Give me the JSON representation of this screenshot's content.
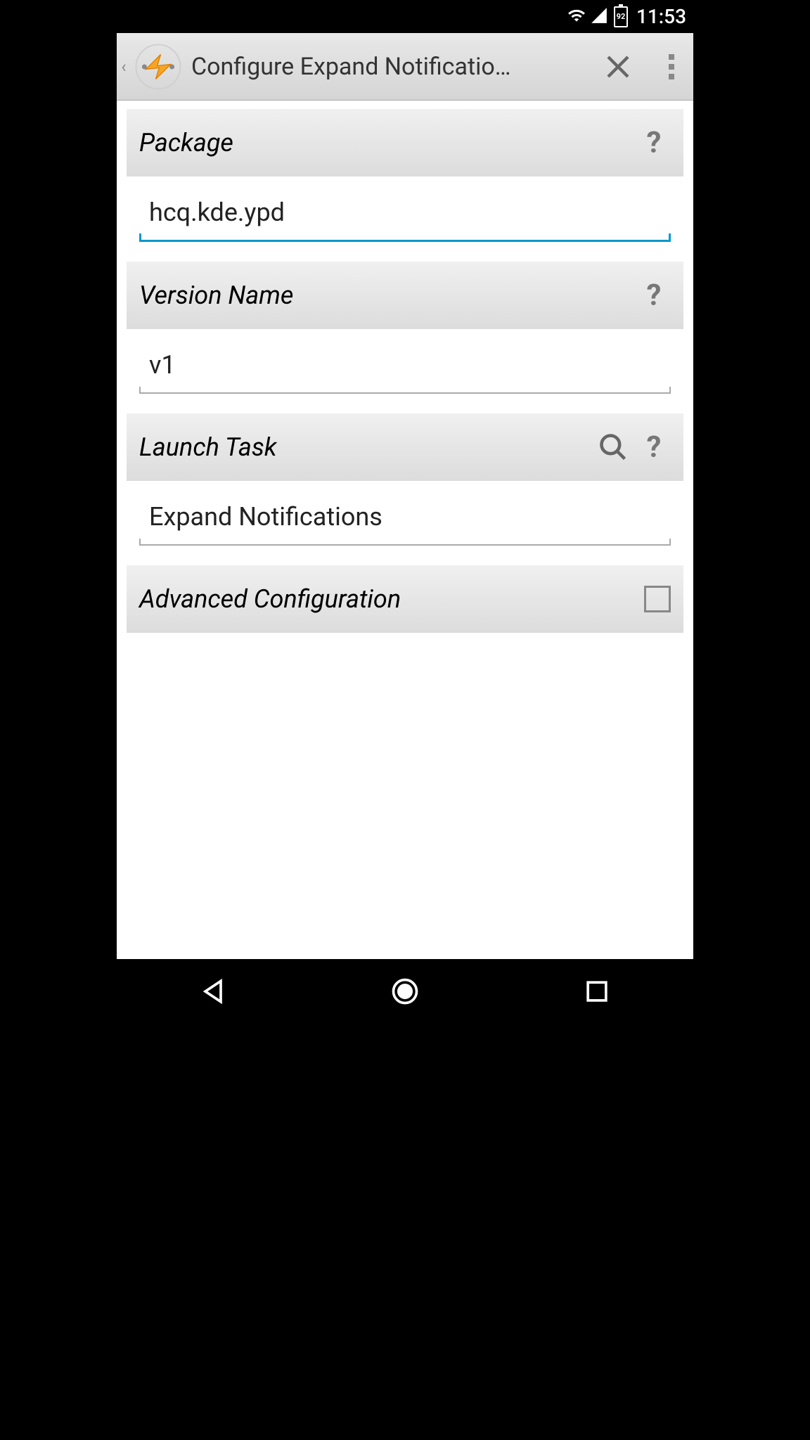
{
  "status_bar": {
    "battery": "92",
    "clock": "11:53"
  },
  "app_bar": {
    "title": "Configure Expand Notificatio…"
  },
  "sections": {
    "package": {
      "label": "Package",
      "value": "hcq.kde.ypd"
    },
    "version_name": {
      "label": "Version Name",
      "value": "v1"
    },
    "launch_task": {
      "label": "Launch Task",
      "value": "Expand Notifications"
    },
    "advanced_config": {
      "label": "Advanced Configuration",
      "checked": false
    }
  }
}
